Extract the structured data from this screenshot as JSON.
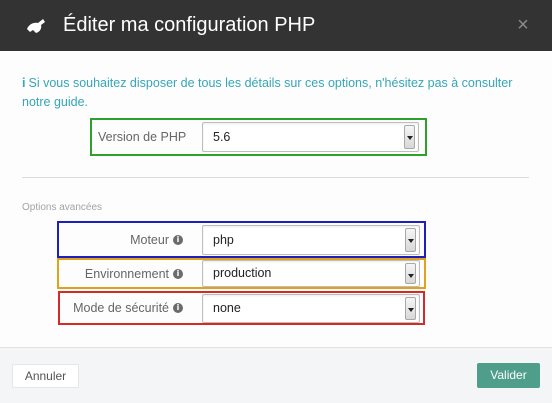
{
  "dialog": {
    "title": "Éditer ma configuration PHP",
    "header_icon": "paw-icon",
    "close_label": "×"
  },
  "info": {
    "icon": "i",
    "text": "Si vous souhaitez disposer de tous les détails sur ces options, n'hésitez pas à consulter notre guide."
  },
  "php_version": {
    "label": "Version de PHP",
    "value": "5.6"
  },
  "advanced": {
    "section_title": "Options avancées",
    "help_icon_glyph": "i",
    "moteur": {
      "label": "Moteur",
      "value": "php"
    },
    "environnement": {
      "label": "Environnement",
      "value": "production"
    },
    "securite": {
      "label": "Mode de sécurité",
      "value": "none"
    }
  },
  "footer": {
    "cancel_label": "Annuler",
    "submit_label": "Valider"
  },
  "colors": {
    "header_bg": "#333333",
    "info_text": "#36a6b8",
    "highlight_green": "#2ea02e",
    "highlight_blue": "#1f1fbf",
    "highlight_orange": "#e0a21a",
    "highlight_red": "#d42a2a",
    "submit_bg": "#4f9e8c"
  }
}
